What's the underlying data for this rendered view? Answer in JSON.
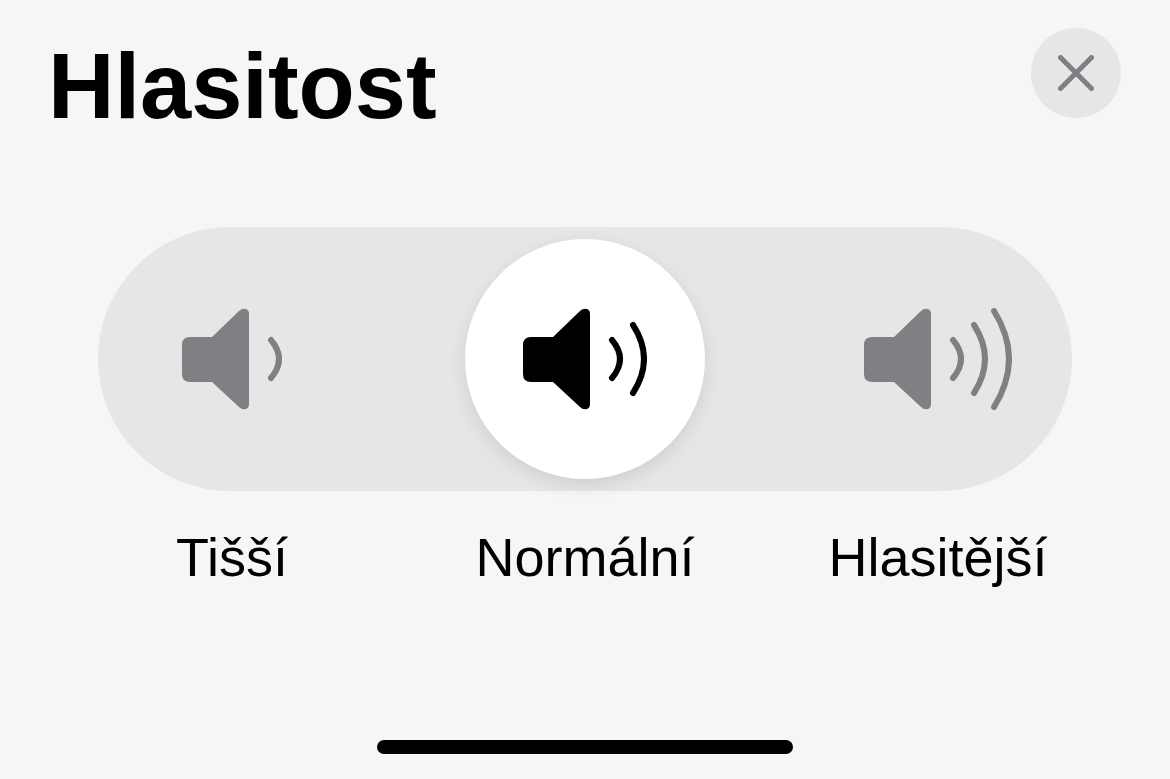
{
  "title": "Hlasitost",
  "volume_options": [
    {
      "label": "Tišší",
      "kind": "quiet",
      "selected": false
    },
    {
      "label": "Normální",
      "kind": "normal",
      "selected": true
    },
    {
      "label": "Hlasitější",
      "kind": "loud",
      "selected": false
    }
  ]
}
